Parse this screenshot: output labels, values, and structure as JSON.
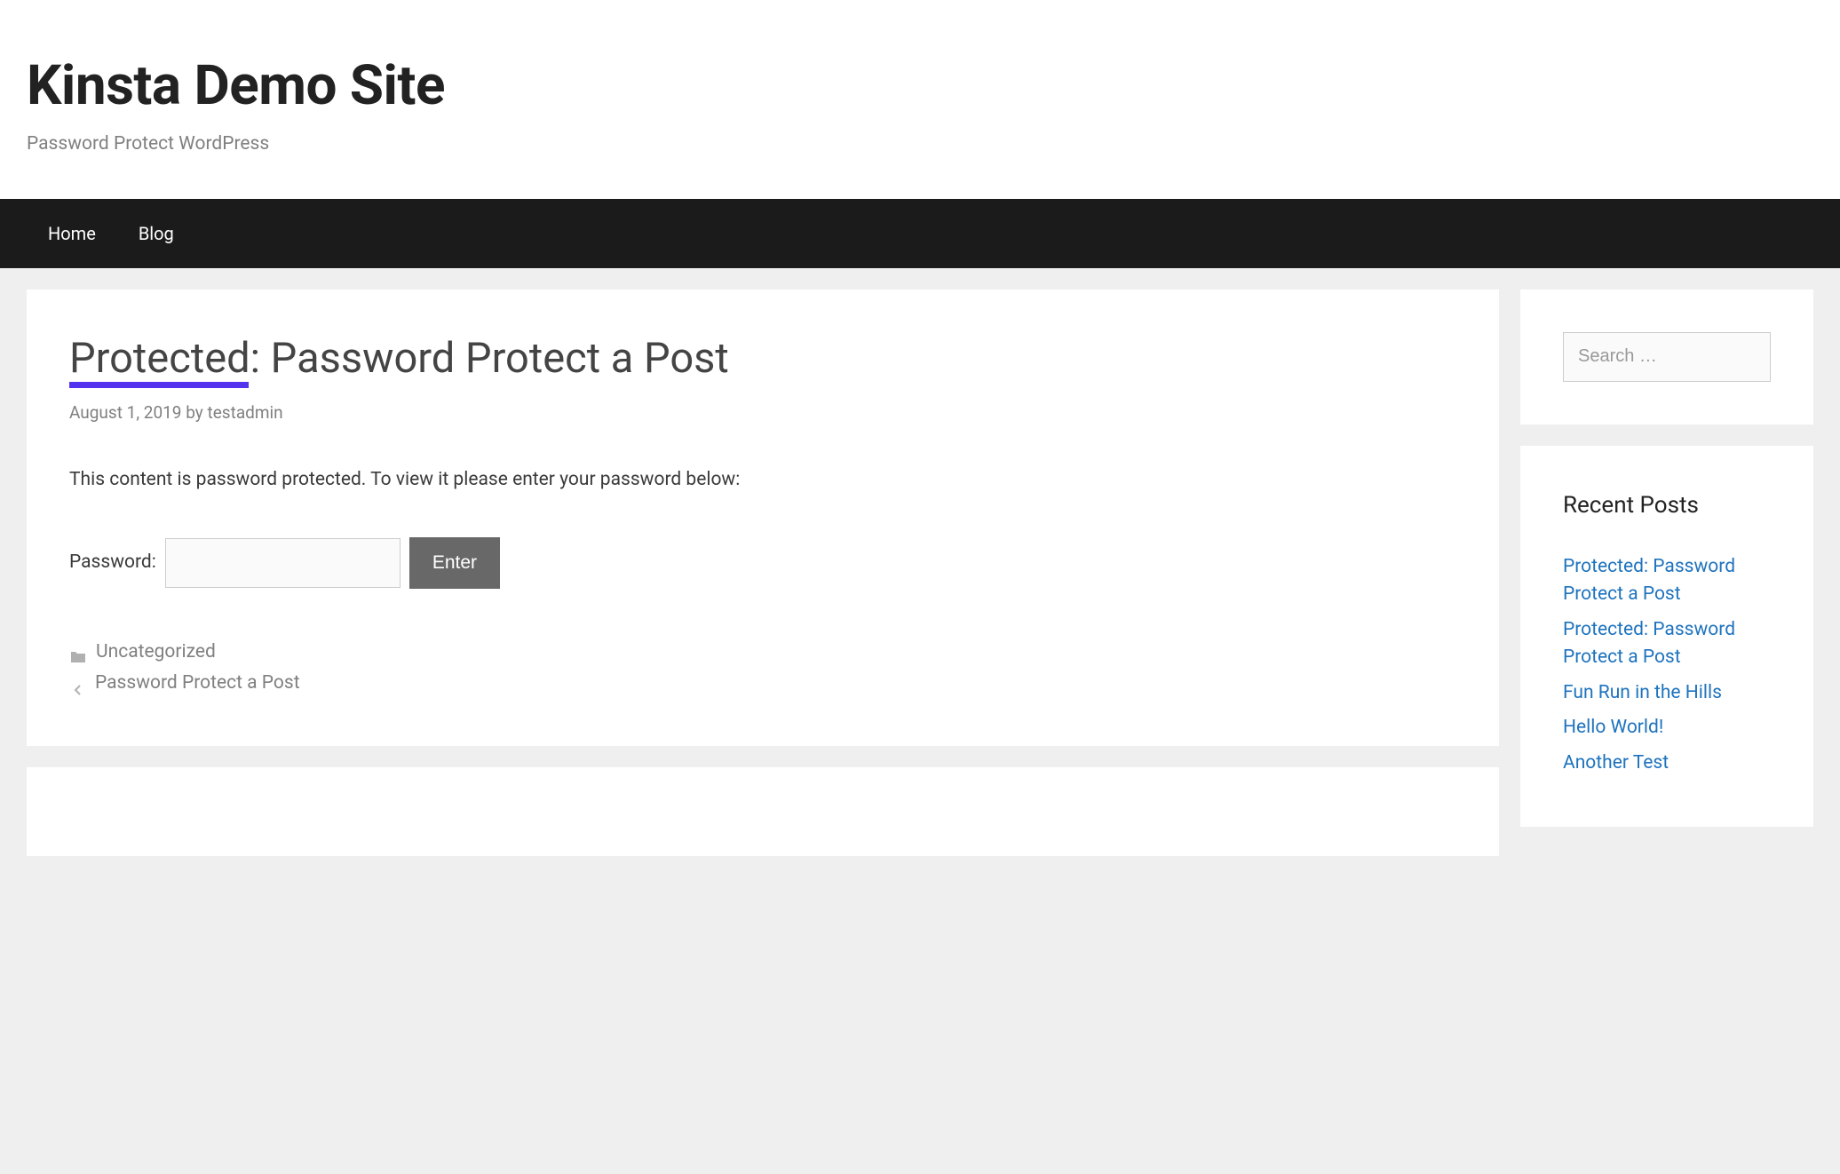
{
  "header": {
    "site_title": "Kinsta Demo Site",
    "site_description": "Password Protect WordPress"
  },
  "nav": {
    "items": [
      {
        "label": "Home"
      },
      {
        "label": "Blog"
      }
    ]
  },
  "article": {
    "title": "Protected: Password Protect a Post",
    "meta": {
      "date": "August 1, 2019",
      "by_label": "by",
      "author": "testadmin"
    },
    "content": "This content is password protected. To view it please enter your password below:",
    "password_form": {
      "label": "Password:",
      "value": "",
      "submit_label": "Enter"
    },
    "footer": {
      "category": "Uncategorized",
      "prev_post": "Password Protect a Post"
    }
  },
  "sidebar": {
    "search": {
      "placeholder": "Search …",
      "value": ""
    },
    "recent_posts": {
      "title": "Recent Posts",
      "items": [
        "Protected: Password Protect a Post",
        "Protected: Password Protect a Post",
        "Fun Run in the Hills",
        "Hello World!",
        "Another Test"
      ]
    }
  }
}
